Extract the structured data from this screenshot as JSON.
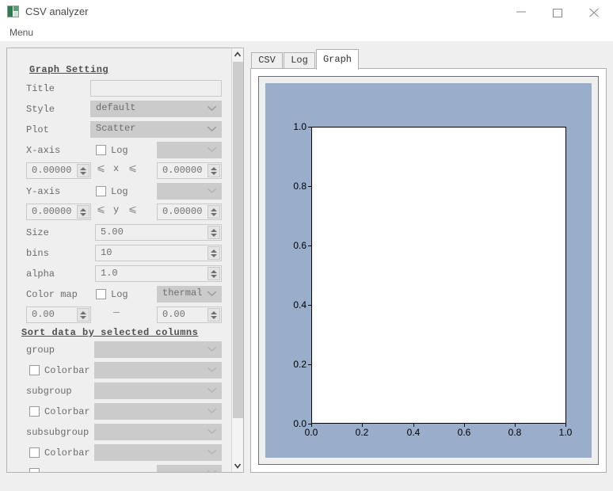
{
  "window": {
    "title": "CSV analyzer",
    "icon": "app-icon",
    "controls": {
      "minimize": "minimize-icon",
      "maximize": "maximize-icon",
      "close": "close-icon"
    }
  },
  "menubar": {
    "items": [
      "Menu"
    ]
  },
  "settings": {
    "graph_section_title": "Graph Setting",
    "sort_section_title": "Sort data by selected columns",
    "labels": {
      "title": "Title",
      "style": "Style",
      "plot": "Plot",
      "x_axis": "X-axis",
      "y_axis": "Y-axis",
      "size": "Size",
      "bins": "bins",
      "alpha": "alpha",
      "color_map": "Color map",
      "log": "Log",
      "colorbar": "Colorbar",
      "group": "group",
      "subgroup": "subgroup",
      "subsubgroup": "subsubgroup",
      "x_var": "x",
      "y_var": "y",
      "le": "⩽",
      "dash": "—"
    },
    "values": {
      "title": "",
      "title_placeholder": "",
      "style": "default",
      "plot": "Scatter",
      "x_column": "",
      "x_min": "0.00000",
      "x_max": "0.00000",
      "y_column": "",
      "y_min": "0.00000",
      "y_max": "0.00000",
      "size": "5.00",
      "bins": "10",
      "alpha": "1.0",
      "color_map": "thermal",
      "cmap_min": "0.00",
      "cmap_max": "0.00",
      "group": "",
      "group_colorbar": "",
      "subgroup": "",
      "subgroup_colorbar": "",
      "subsubgroup": "",
      "subsubgroup_colorbar": ""
    },
    "checkboxes": {
      "x_log": false,
      "y_log": false,
      "cmap_log": false,
      "group_colorbar": false,
      "subgroup_colorbar": false,
      "subsubgroup_colorbar": false
    }
  },
  "tabs": [
    {
      "label": "CSV",
      "active": false
    },
    {
      "label": "Log",
      "active": false
    },
    {
      "label": "Graph",
      "active": true
    }
  ],
  "colors": {
    "figure_face": "#99aecb",
    "axes_face": "#ffffff",
    "window_bg": "#efefef",
    "combo_bg": "#cbcbcb"
  },
  "chart_data": {
    "type": "scatter",
    "title": "",
    "xlabel": "",
    "ylabel": "",
    "xlim": [
      0.0,
      1.0
    ],
    "ylim": [
      0.0,
      1.0
    ],
    "xticks": [
      "0.0",
      "0.2",
      "0.4",
      "0.6",
      "0.8",
      "1.0"
    ],
    "yticks": [
      "0.0",
      "0.2",
      "0.4",
      "0.6",
      "0.8",
      "1.0"
    ],
    "series": [],
    "grid": false,
    "legend": false,
    "figure_facecolor": "#99aecb",
    "axes_facecolor": "#ffffff"
  }
}
